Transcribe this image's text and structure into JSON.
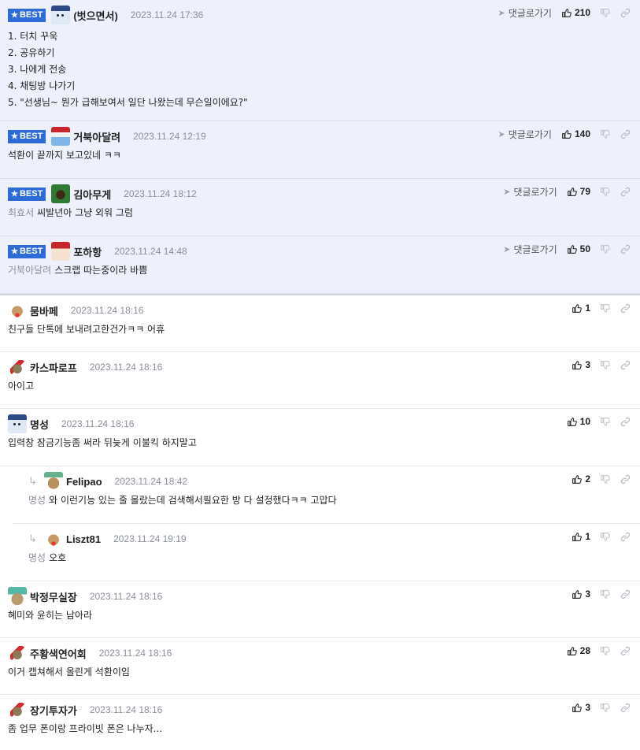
{
  "ui": {
    "best_label": "BEST",
    "goto_label": "댓글로가기"
  },
  "comments": [
    {
      "best": true,
      "avatar": "snowman-avatar",
      "nick": "(벗으면서)",
      "date": "2023.11.24 17:36",
      "likes": "210",
      "mention": "",
      "lines": [
        "1. 터치 꾸욱",
        "2. 공유하기",
        "3. 나에게 전송",
        "4. 채팅방 나가기",
        "5. \"선생님~ 뭔가 급해보여서 일단 나왔는데 무슨일이에요?\""
      ]
    },
    {
      "best": true,
      "avatar": "santa-avatar",
      "nick": "거북아달려",
      "date": "2023.11.24 12:19",
      "likes": "140",
      "mention": "",
      "lines": [
        "석환이 끝까지 보고있네 ㅋㅋ"
      ]
    },
    {
      "best": true,
      "avatar": "green-dog-avatar",
      "nick": "김아무게",
      "date": "2023.11.24 18:12",
      "likes": "79",
      "mention": "최효서",
      "lines": [
        "씨발년아 그냥 외워 그럼"
      ]
    },
    {
      "best": true,
      "avatar": "santa-hat-avatar",
      "nick": "포하항",
      "date": "2023.11.24 14:48",
      "likes": "50",
      "mention": "거북아달려",
      "lines": [
        "스크랩 따는중이라 바쁨"
      ]
    },
    {
      "best": false,
      "avatar": "reindeer-avatar",
      "nick": "뭄바페",
      "date": "2023.11.24 18:16",
      "likes": "1",
      "mention": "",
      "lines": [
        "친구들 단톡에 보내려고한건가ㅋㅋ 어휴"
      ]
    },
    {
      "best": false,
      "avatar": "bow-avatar",
      "nick": "카스파로프",
      "date": "2023.11.24 18:16",
      "likes": "3",
      "mention": "",
      "lines": [
        "아이고"
      ]
    },
    {
      "best": false,
      "avatar": "snowman-avatar",
      "nick": "명성",
      "date": "2023.11.24 18:16",
      "likes": "10",
      "mention": "",
      "lines": [
        "입력창 잠금기능좀 써라 뒤늦게 이불킥 하지말고"
      ]
    },
    {
      "best": false,
      "reply": true,
      "avatar": "pug-avatar",
      "nick": "Felipao",
      "date": "2023.11.24 18:42",
      "likes": "2",
      "mention": "명성",
      "lines": [
        "와 이런기능 있는 줄 몰랐는데 검색해서필요한 방 다 설정했다ㅋㅋ 고맙다"
      ]
    },
    {
      "best": false,
      "reply": true,
      "avatar": "reindeer-avatar",
      "nick": "Liszt81",
      "date": "2023.11.24 19:19",
      "likes": "1",
      "mention": "명성",
      "lines": [
        "오호"
      ]
    },
    {
      "best": false,
      "avatar": "hat-avatar",
      "nick": "박정무실장",
      "date": "2023.11.24 18:16",
      "likes": "3",
      "mention": "",
      "lines": [
        "혜미와 윤히는 남아라"
      ]
    },
    {
      "best": false,
      "avatar": "bow-avatar",
      "nick": "주황색연어회",
      "date": "2023.11.24 18:16",
      "likes": "28",
      "mention": "",
      "lines": [
        "이거 캡쳐해서 올린게 석환이임"
      ]
    },
    {
      "best": false,
      "avatar": "bow-avatar",
      "nick": "장기투자가",
      "date": "2023.11.24 18:16",
      "likes": "3",
      "mention": "",
      "lines": [
        "좀 업무 폰이랑 프라이빗 폰은 나누자..."
      ]
    }
  ]
}
